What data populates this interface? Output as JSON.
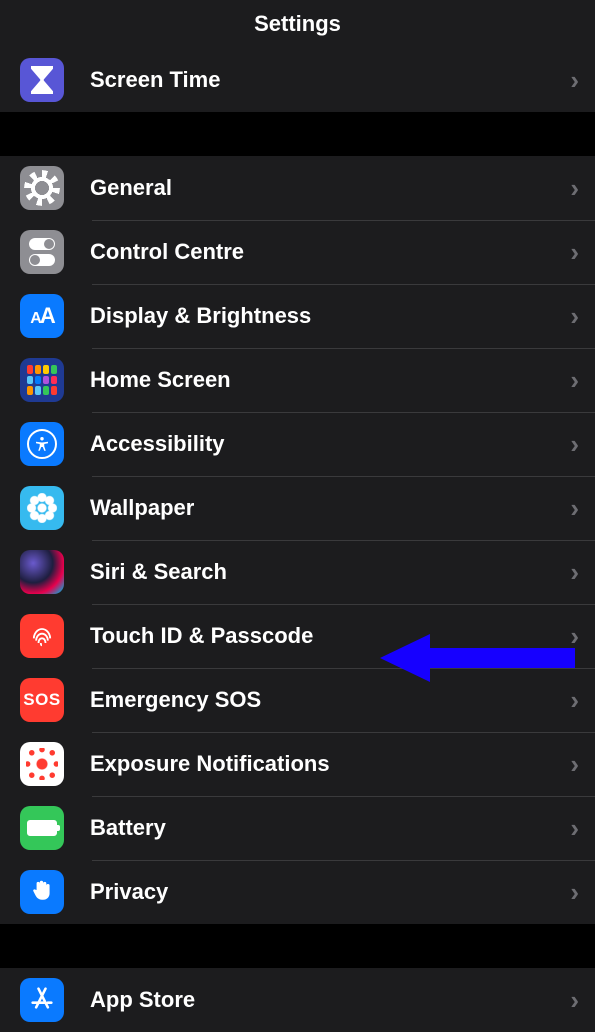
{
  "header": {
    "title": "Settings"
  },
  "groups": [
    {
      "rows": [
        {
          "id": "screen-time",
          "label": "Screen Time"
        }
      ]
    },
    {
      "rows": [
        {
          "id": "general",
          "label": "General"
        },
        {
          "id": "control-centre",
          "label": "Control Centre"
        },
        {
          "id": "display-brightness",
          "label": "Display & Brightness"
        },
        {
          "id": "home-screen",
          "label": "Home Screen"
        },
        {
          "id": "accessibility",
          "label": "Accessibility"
        },
        {
          "id": "wallpaper",
          "label": "Wallpaper"
        },
        {
          "id": "siri-search",
          "label": "Siri & Search"
        },
        {
          "id": "touch-id-passcode",
          "label": "Touch ID & Passcode"
        },
        {
          "id": "emergency-sos",
          "label": "Emergency SOS"
        },
        {
          "id": "exposure-notifications",
          "label": "Exposure Notifications"
        },
        {
          "id": "battery",
          "label": "Battery"
        },
        {
          "id": "privacy",
          "label": "Privacy"
        }
      ]
    },
    {
      "rows": [
        {
          "id": "app-store",
          "label": "App Store"
        }
      ]
    }
  ],
  "annotation": {
    "points_to": "touch-id-passcode",
    "color": "#1600ff"
  }
}
